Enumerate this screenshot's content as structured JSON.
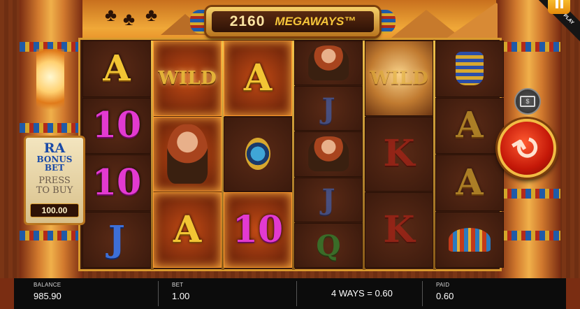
{
  "header": {
    "ways_count": "2160",
    "megaways": "MEGAWAYS™",
    "demo_label": "DEMO PLAY"
  },
  "reels": [
    [
      {
        "type": "letter",
        "text": "A",
        "cls": "A",
        "hl": false
      },
      {
        "type": "letter",
        "text": "10",
        "cls": "ten",
        "hl": false
      },
      {
        "type": "letter",
        "text": "10",
        "cls": "ten",
        "hl": false
      },
      {
        "type": "letter",
        "text": "J",
        "cls": "J",
        "hl": false
      }
    ],
    [
      {
        "type": "wild",
        "text": "WILD",
        "hl": true
      },
      {
        "type": "woman",
        "hl": true
      },
      {
        "type": "letter",
        "text": "A",
        "cls": "A",
        "hl": true
      }
    ],
    [
      {
        "type": "letter",
        "text": "A",
        "cls": "A",
        "hl": true
      },
      {
        "type": "scarab",
        "hl": false
      },
      {
        "type": "letter",
        "text": "10",
        "cls": "ten",
        "hl": true
      }
    ],
    [
      {
        "type": "woman",
        "hl": false
      },
      {
        "type": "letter",
        "text": "J",
        "cls": "J",
        "hl": false
      },
      {
        "type": "woman",
        "hl": false
      },
      {
        "type": "letter",
        "text": "J",
        "cls": "J",
        "hl": false
      },
      {
        "type": "letter",
        "text": "Q",
        "cls": "Q",
        "hl": false
      }
    ],
    [
      {
        "type": "wild",
        "text": "WILD",
        "hl": false
      },
      {
        "type": "letter",
        "text": "K",
        "cls": "K",
        "hl": false
      },
      {
        "type": "letter",
        "text": "K",
        "cls": "K",
        "hl": false
      }
    ],
    [
      {
        "type": "pharaoh",
        "hl": false
      },
      {
        "type": "letter",
        "text": "A",
        "cls": "A",
        "hl": false
      },
      {
        "type": "letter",
        "text": "A",
        "cls": "A",
        "hl": false
      },
      {
        "type": "bird",
        "hl": false
      }
    ]
  ],
  "bonus": {
    "ra": "RA",
    "bonus_bet": "BONUS BET",
    "press": "PRESS",
    "to_buy": "TO BUY",
    "price": "100.00"
  },
  "icons": {
    "spin": "spin-icon",
    "cash": "cash-icon",
    "menu": "menu-icon"
  },
  "status": {
    "balance_label": "BALANCE",
    "balance_value": "985.90",
    "bet_label": "BET",
    "bet_value": "1.00",
    "ways_win": "4 WAYS = 0.60",
    "paid_label": "PAID",
    "paid_value": "0.60"
  }
}
